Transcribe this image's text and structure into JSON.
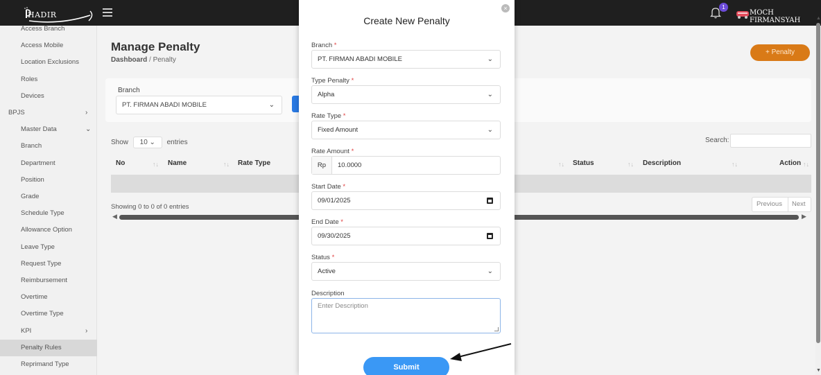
{
  "topbar": {
    "logo_text": "HADIR",
    "user_name": "MOCH FIRMANSYAH",
    "notification_count": "1"
  },
  "sidebar": {
    "items": [
      {
        "label": "Access Branch",
        "level": 1
      },
      {
        "label": "Access Mobile",
        "level": 1
      },
      {
        "label": "Location Exclusions",
        "level": 1
      },
      {
        "label": "Roles",
        "level": 1
      },
      {
        "label": "Devices",
        "level": 1
      },
      {
        "label": "BPJS",
        "level": 0,
        "chevron": ">"
      },
      {
        "label": "Master Data",
        "level": 1,
        "chevron": "v"
      },
      {
        "label": "Branch",
        "level": 1
      },
      {
        "label": "Department",
        "level": 1
      },
      {
        "label": "Position",
        "level": 1
      },
      {
        "label": "Grade",
        "level": 1
      },
      {
        "label": "Schedule Type",
        "level": 1
      },
      {
        "label": "Allowance Option",
        "level": 1
      },
      {
        "label": "Leave Type",
        "level": 1
      },
      {
        "label": "Request Type",
        "level": 1
      },
      {
        "label": "Reimbursement",
        "level": 1
      },
      {
        "label": "Overtime",
        "level": 1
      },
      {
        "label": "Overtime Type",
        "level": 1
      },
      {
        "label": "KPI",
        "level": 1,
        "chevron": ">"
      },
      {
        "label": "Penalty Rules",
        "level": 1,
        "active": true
      },
      {
        "label": "Reprimand Type",
        "level": 1
      }
    ]
  },
  "page": {
    "title": "Manage Penalty",
    "breadcrumb_home": "Dashboard",
    "breadcrumb_sep": "/",
    "breadcrumb_current": "Penalty",
    "add_button": "+ Penalty"
  },
  "filter": {
    "branch_label": "Branch",
    "branch_value": "PT. FIRMAN ABADI MOBILE"
  },
  "table": {
    "show_label": "Show",
    "entries_value": "10",
    "entries_label": "entries",
    "search_label": "Search:",
    "columns": [
      "No",
      "Name",
      "Rate Type",
      "Status",
      "Description",
      "Action"
    ],
    "showing_text": "Showing 0 to 0 of 0 entries",
    "prev_label": "Previous",
    "next_label": "Next"
  },
  "modal": {
    "title": "Create New Penalty",
    "fields": {
      "branch": {
        "label": "Branch",
        "value": "PT. FIRMAN ABADI MOBILE"
      },
      "type_penalty": {
        "label": "Type Penalty",
        "value": "Alpha"
      },
      "rate_type": {
        "label": "Rate Type",
        "value": "Fixed Amount"
      },
      "rate_amount": {
        "label": "Rate Amount",
        "prefix": "Rp",
        "value": "10.0000"
      },
      "start_date": {
        "label": "Start Date",
        "value": "09/01/2025"
      },
      "end_date": {
        "label": "End Date",
        "value": "09/30/2025"
      },
      "status": {
        "label": "Status",
        "value": "Active"
      },
      "description": {
        "label": "Description",
        "placeholder": "Enter Description"
      }
    },
    "required_mark": "*",
    "submit_label": "Submit"
  },
  "colors": {
    "topbar_bg": "#1f1f1f",
    "accent_orange": "#d97a17",
    "submit_blue": "#3a98f5",
    "required_red": "#e04040",
    "badge_purple": "#6c4bd8"
  }
}
